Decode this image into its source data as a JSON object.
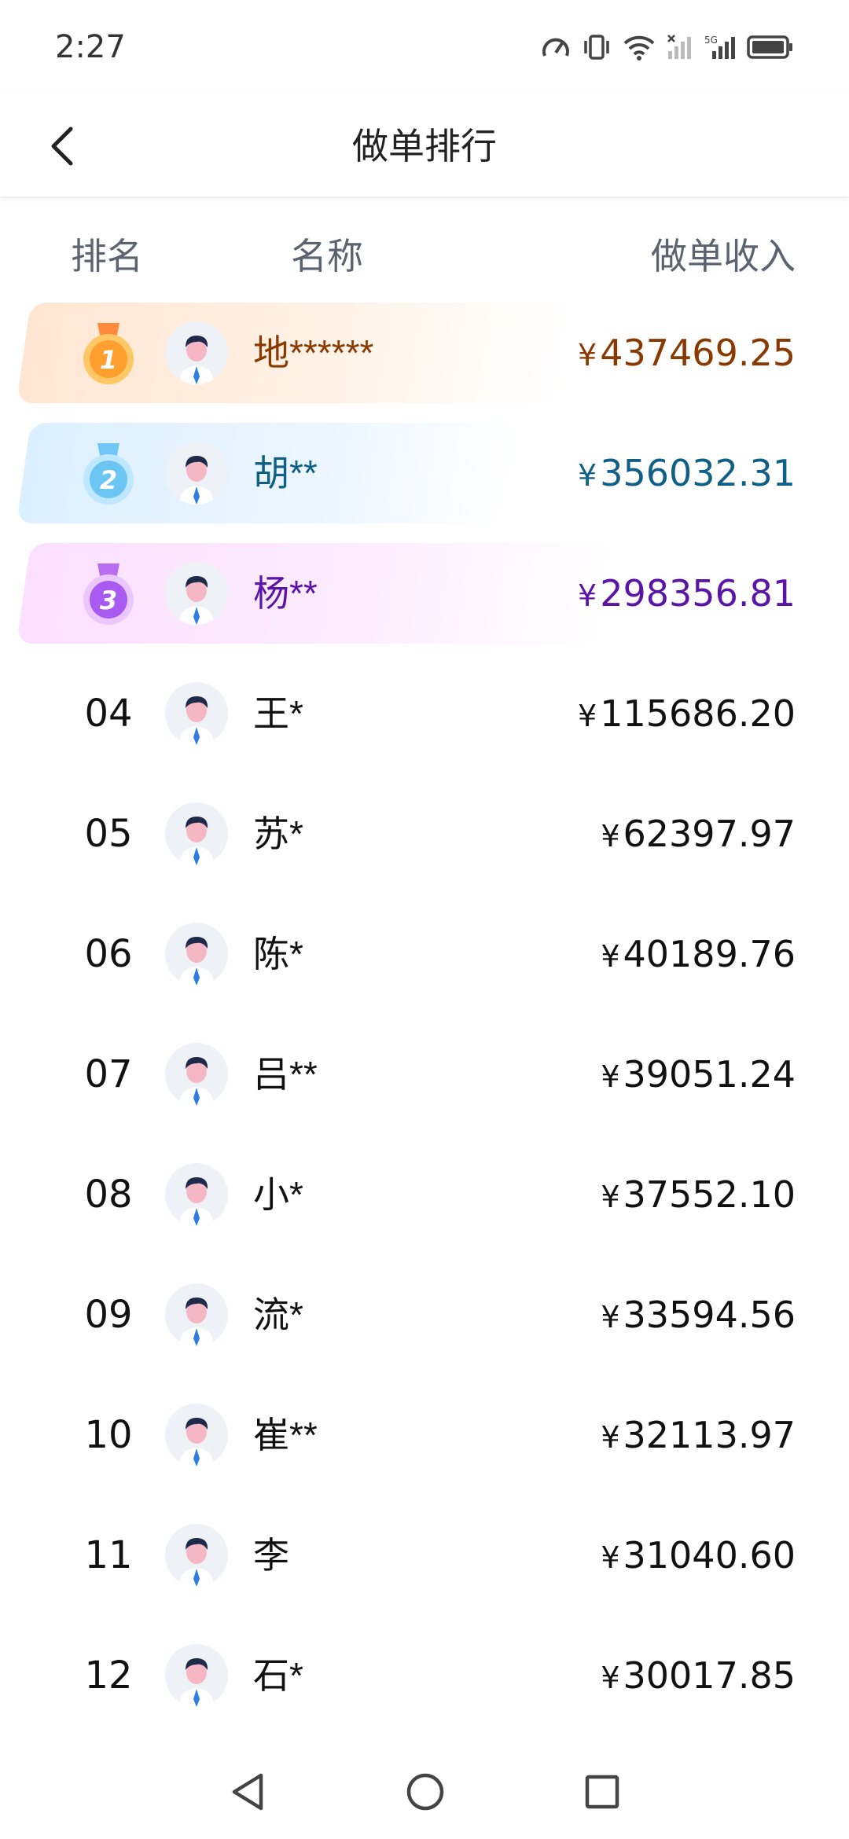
{
  "status_bar": {
    "time": "2:27"
  },
  "header": {
    "title": "做单排行"
  },
  "columns": {
    "rank": "排名",
    "name": "名称",
    "income": "做单收入"
  },
  "currency_symbol": "¥",
  "rows": [
    {
      "rank": "1",
      "name": "地******",
      "income": "437469.25",
      "medal": "gold"
    },
    {
      "rank": "2",
      "name": "胡**",
      "income": "356032.31",
      "medal": "silver"
    },
    {
      "rank": "3",
      "name": "杨**",
      "income": "298356.81",
      "medal": "bronze"
    },
    {
      "rank": "04",
      "name": "王*",
      "income": "115686.20"
    },
    {
      "rank": "05",
      "name": "苏*",
      "income": "62397.97"
    },
    {
      "rank": "06",
      "name": "陈*",
      "income": "40189.76"
    },
    {
      "rank": "07",
      "name": "吕**",
      "income": "39051.24"
    },
    {
      "rank": "08",
      "name": "小*",
      "income": "37552.10"
    },
    {
      "rank": "09",
      "name": "流*",
      "income": "33594.56"
    },
    {
      "rank": "10",
      "name": "崔**",
      "income": "32113.97"
    },
    {
      "rank": "11",
      "name": "李",
      "income": "31040.60"
    },
    {
      "rank": "12",
      "name": "石*",
      "income": "30017.85"
    }
  ],
  "colors": {
    "gold": "#8a3a00",
    "silver": "#0f5f86",
    "bronze": "#5a14a8"
  },
  "icons": {
    "status": [
      "speed-icon",
      "vibrate-icon",
      "wifi-icon",
      "signal-icon",
      "5g-signal-icon",
      "battery-icon"
    ],
    "nav": [
      "back-triangle-icon",
      "home-circle-icon",
      "recents-square-icon"
    ]
  }
}
